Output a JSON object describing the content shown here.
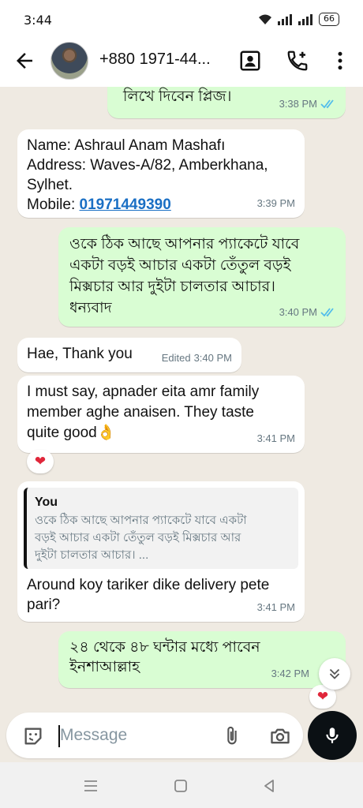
{
  "status_bar": {
    "time": "3:44",
    "battery": "66"
  },
  "header": {
    "contact_name": "+880 1971-44..."
  },
  "messages": {
    "m1": {
      "text": "লিখে দিবেন প্লিজ।",
      "time": "3:38 PM"
    },
    "m2": {
      "name_line": "Name: Ashraul Anam Mashafı",
      "address_line1": "Address: Waves-A/82, Amberkhana,",
      "address_line2": "Sylhet.",
      "mobile_label": "Mobile: ",
      "mobile_number": "01971449390",
      "time": "3:39 PM"
    },
    "m3": {
      "line1": "ওকে ঠিক আছে আপনার প্যাকেটে যাবে",
      "line2": "একটা বড়ই আচার একটা তেঁতুল বড়ই",
      "line3": "মিক্সচার আর দুইটা চালতার আচার।",
      "line4": "ধন্যবাদ",
      "time": "3:40 PM"
    },
    "m4": {
      "text": "Hae, Thank you",
      "edited": "Edited",
      "time": "3:40 PM"
    },
    "m5": {
      "line1": "I must say, apnader eita amr family",
      "line2": "member aghe anaisen. They taste",
      "line3": "quite good👌",
      "time": "3:41 PM",
      "reaction": "❤"
    },
    "m6": {
      "quote_author": "You",
      "quote_line1": "ওকে ঠিক আছে আপনার প্যাকেটে যাবে একটা",
      "quote_line2": "বড়ই আচার একটা তেঁতুল বড়ই মিক্সচার আর",
      "quote_line3": "দুইটা চালতার আচার। ...",
      "line1": "Around koy tariker dike delivery pete",
      "line2": "pari?",
      "time": "3:41 PM"
    },
    "m7": {
      "line1": "২৪ থেকে ৪৮ ঘন্টার মধ্যে পাবেন",
      "line2": "ইনশাআল্লাহ",
      "time": "3:42 PM",
      "reaction": "❤"
    }
  },
  "input": {
    "placeholder": "Message"
  },
  "colors": {
    "outgoing_bubble": "#d9fdd3",
    "incoming_bubble": "#ffffff",
    "chat_background": "#efeae2",
    "read_ticks": "#53bdeb",
    "link": "#1a6fc4",
    "mic_button": "#0b1014"
  },
  "icons": {
    "back": "arrow-left-icon",
    "contact_card": "contact-card-icon",
    "add_call": "add-call-icon",
    "menu": "more-vert-icon",
    "sticker": "sticker-icon",
    "attach": "paperclip-icon",
    "camera": "camera-icon",
    "mic": "mic-icon",
    "scroll_down": "double-chevron-down-icon"
  }
}
